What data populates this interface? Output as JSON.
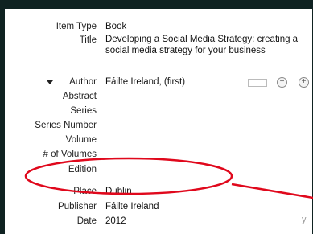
{
  "fields": {
    "item_type": {
      "label": "Item Type",
      "value": "Book"
    },
    "title": {
      "label": "Title",
      "value": "Developing a Social Media Strategy: creating a social media strategy for your business"
    },
    "author": {
      "label": "Author",
      "value": "Fáilte Ireland, (first)"
    },
    "abstract": {
      "label": "Abstract",
      "value": ""
    },
    "series": {
      "label": "Series",
      "value": ""
    },
    "series_number": {
      "label": "Series Number",
      "value": ""
    },
    "volume": {
      "label": "Volume",
      "value": ""
    },
    "num_volumes": {
      "label": "# of Volumes",
      "value": ""
    },
    "edition": {
      "label": "Edition",
      "value": ""
    },
    "place": {
      "label": "Place",
      "value": "Dublin"
    },
    "publisher": {
      "label": "Publisher",
      "value": "Fáilte Ireland"
    },
    "date": {
      "label": "Date",
      "value": "2012"
    }
  },
  "author_controls": {
    "minus": "−",
    "plus": "+"
  },
  "corner_text": "y",
  "colors": {
    "annotation": "#e0081c",
    "frame": "#0f2221",
    "pane": "#ffffff"
  },
  "icons": {
    "author_toggle": "triangle-down-icon",
    "remove": "minus-circle-icon",
    "add": "plus-circle-icon"
  }
}
